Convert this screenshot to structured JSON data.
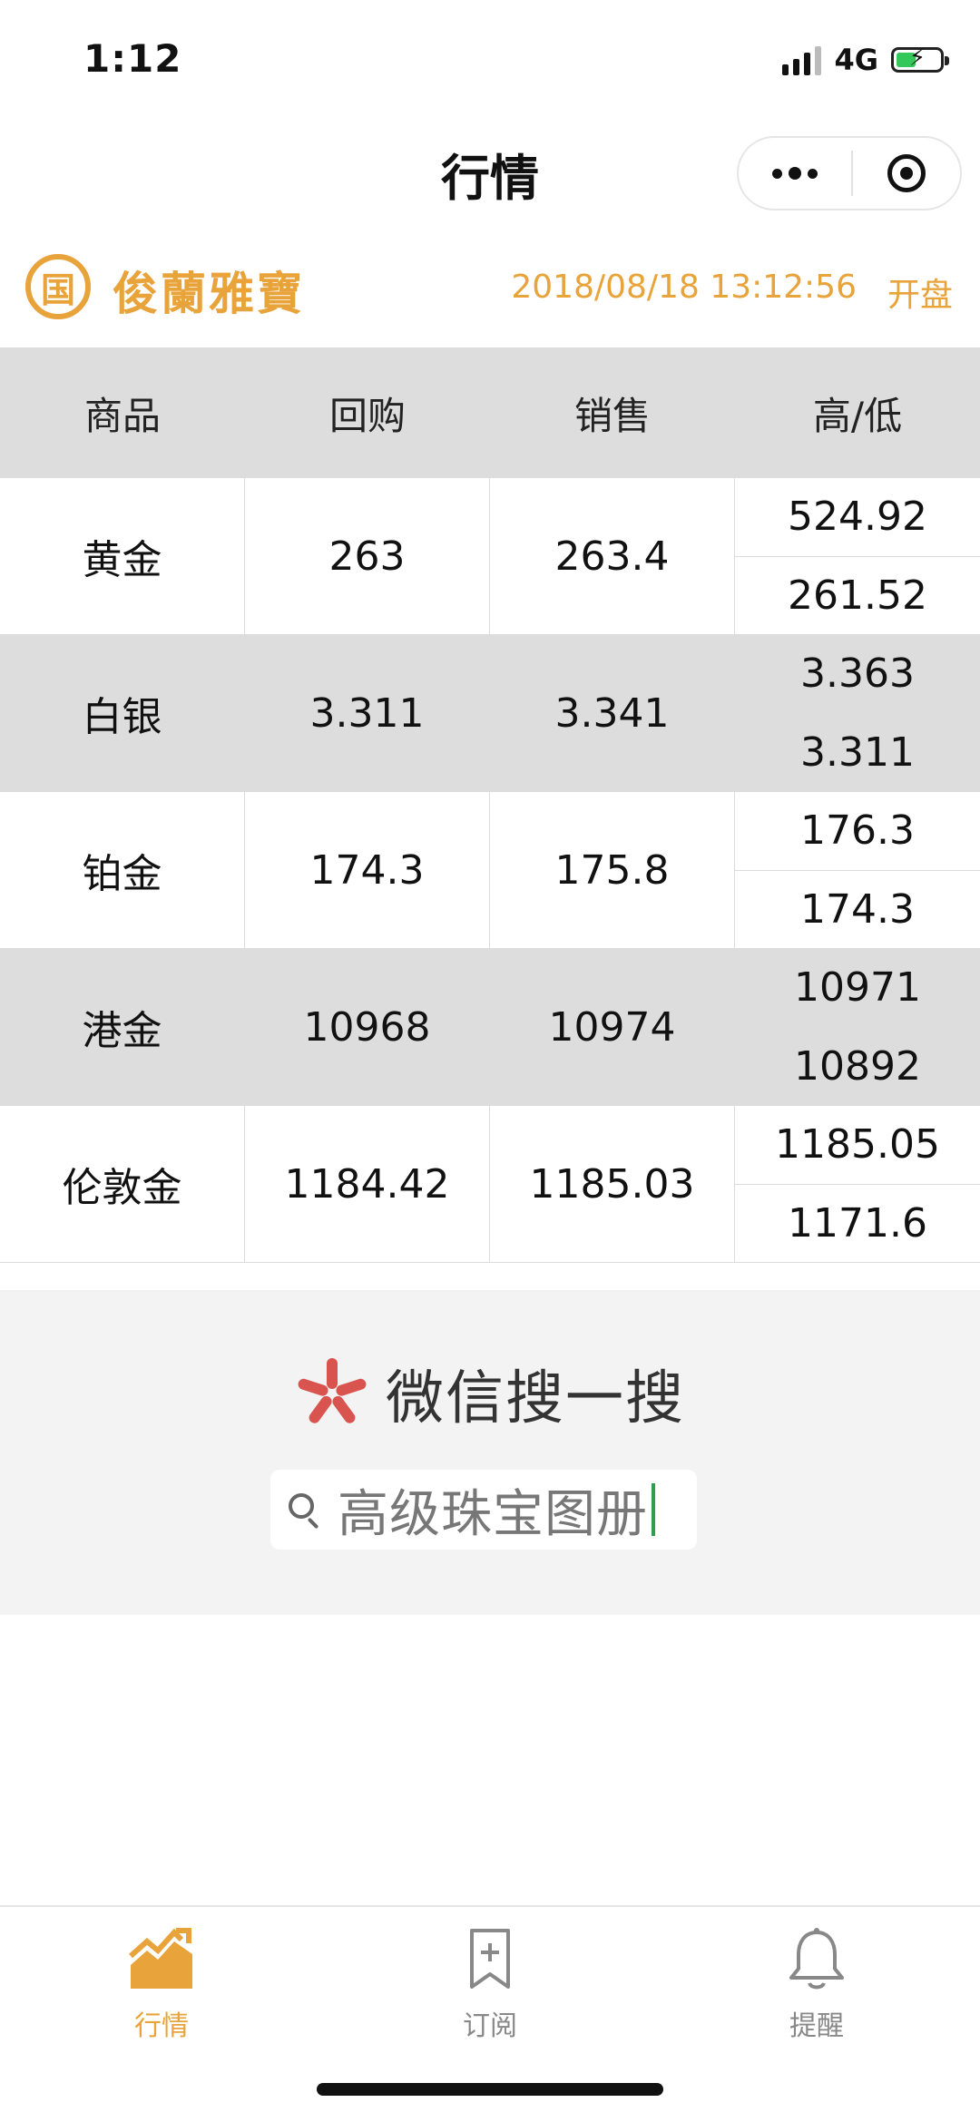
{
  "status_bar": {
    "time": "1:12",
    "network": "4G"
  },
  "nav": {
    "title": "行情"
  },
  "brand": {
    "logo_char": "国",
    "name": "俊蘭雅寶",
    "datetime": "2018/08/18 13:12:56",
    "market_status": "开盘",
    "accent_color": "#e8a33a"
  },
  "table": {
    "headers": [
      "商品",
      "回购",
      "销售",
      "高/低"
    ],
    "rows": [
      {
        "name": "黄金",
        "buyback": "263",
        "sale": "263.4",
        "high": "524.92",
        "low": "261.52"
      },
      {
        "name": "白银",
        "buyback": "3.311",
        "sale": "3.341",
        "high": "3.363",
        "low": "3.311"
      },
      {
        "name": "铂金",
        "buyback": "174.3",
        "sale": "175.8",
        "high": "176.3",
        "low": "174.3"
      },
      {
        "name": "港金",
        "buyback": "10968",
        "sale": "10974",
        "high": "10971",
        "low": "10892"
      },
      {
        "name": "伦敦金",
        "buyback": "1184.42",
        "sale": "1185.03",
        "high": "1185.05",
        "low": "1171.6"
      }
    ]
  },
  "search_banner": {
    "brand_text": "微信搜一搜",
    "query": "高级珠宝图册"
  },
  "tabs": [
    {
      "label": "行情",
      "icon": "chart-trend-icon",
      "active": true
    },
    {
      "label": "订阅",
      "icon": "bookmark-add-icon",
      "active": false
    },
    {
      "label": "提醒",
      "icon": "bell-icon",
      "active": false
    }
  ]
}
